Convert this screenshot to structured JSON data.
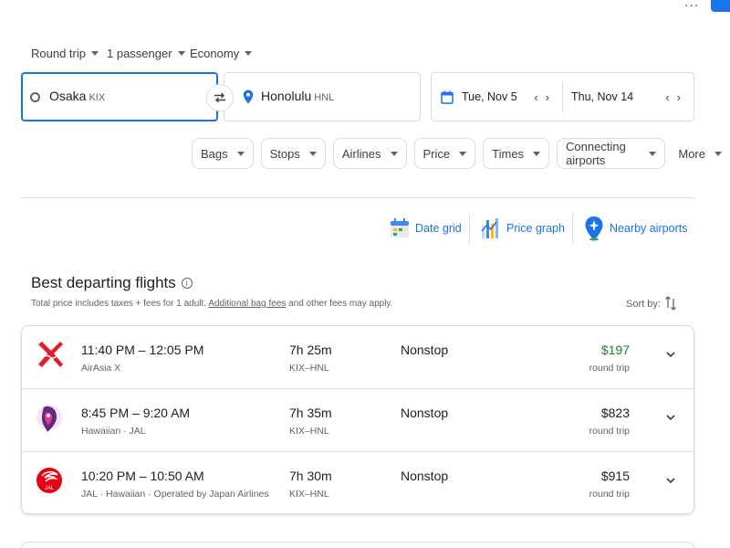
{
  "colors": {
    "accent": "#1a73e8",
    "price_low": "#188038",
    "border": "#dadce0"
  },
  "top": {
    "more_menu": "...",
    "trip_type": "Round trip",
    "passengers": "1 passenger",
    "cabin": "Economy"
  },
  "search": {
    "origin_city": "Osaka",
    "origin_code": "KIX",
    "destination_city": "Honolulu",
    "destination_code": "HNL",
    "depart_date": "Tue, Nov 5",
    "return_date": "Thu, Nov 14"
  },
  "filters": [
    "Bags",
    "Stops",
    "Airlines",
    "Price",
    "Times",
    "Connecting airports",
    "More"
  ],
  "tools": {
    "date_grid": "Date grid",
    "price_graph": "Price graph",
    "nearby_airports": "Nearby airports"
  },
  "results": {
    "title": "Best departing flights",
    "info_glyph": "i",
    "subtitle_pre": "Total price includes taxes + fees for 1 adult. ",
    "subtitle_link": "Additional bag fees",
    "subtitle_post": " and other fees may apply.",
    "sort_by": "Sort by:",
    "flights": [
      {
        "times": "11:40 PM – 12:05 PM",
        "airline": "AirAsia X",
        "duration": "7h 25m",
        "route": "KIX–HNL",
        "stops": "Nonstop",
        "price": "$197",
        "price_note": "round trip",
        "logo": "airasia-logo"
      },
      {
        "times": "8:45 PM – 9:20 AM",
        "airline": "Hawaiian · JAL",
        "duration": "7h 35m",
        "route": "KIX–HNL",
        "stops": "Nonstop",
        "price": "$823",
        "price_note": "round trip",
        "logo": "hawaiian-logo"
      },
      {
        "times": "10:20 PM – 10:50 AM",
        "airline": "JAL · Hawaiian · Operated by Japan Airlines",
        "duration": "7h 30m",
        "route": "KIX–HNL",
        "stops": "Nonstop",
        "price": "$915",
        "price_note": "round trip",
        "logo": "jal-logo",
        "logo_text": "JAL"
      }
    ]
  }
}
